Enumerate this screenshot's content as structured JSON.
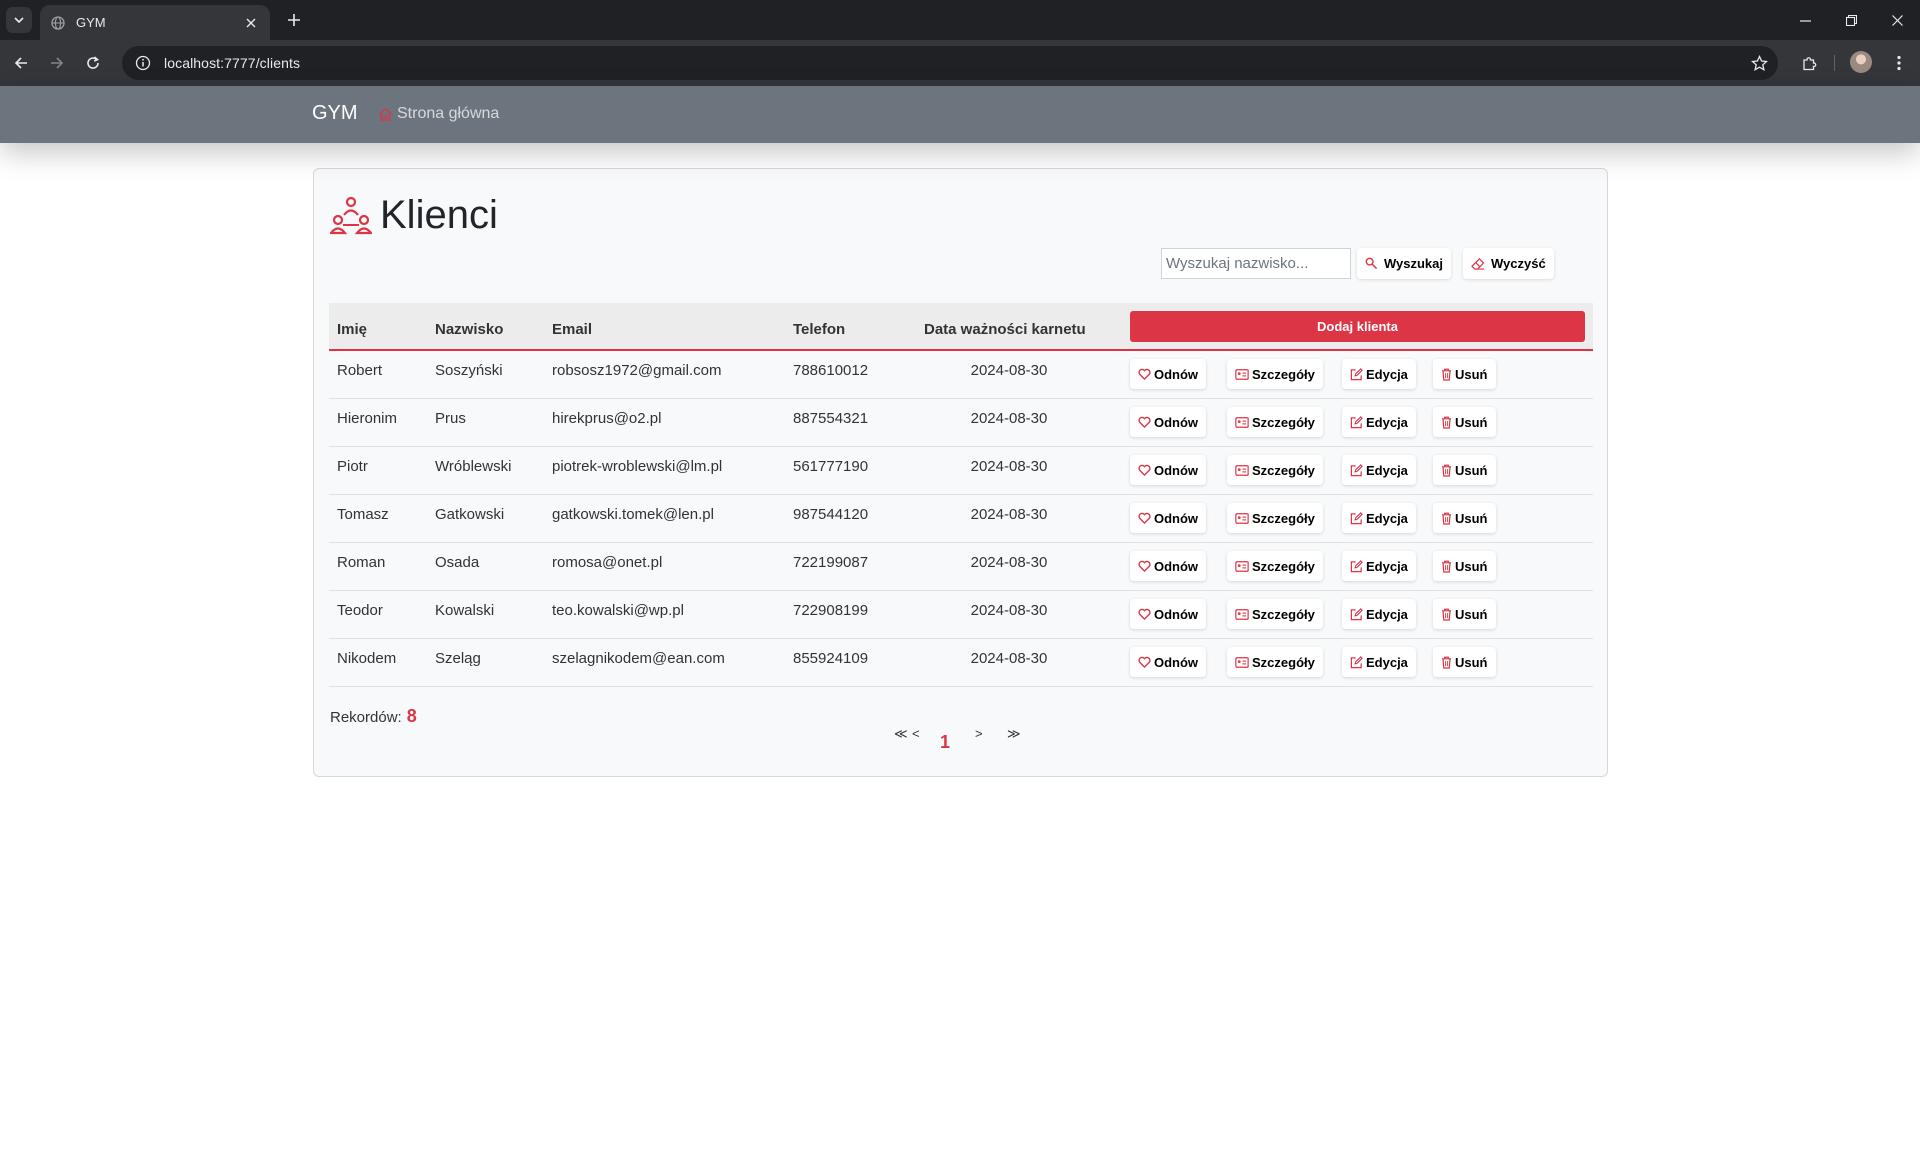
{
  "browser": {
    "tab_title": "GYM",
    "url": "localhost:7777/clients"
  },
  "navbar": {
    "brand": "GYM",
    "home_link": "Strona główna"
  },
  "page": {
    "title": "Klienci",
    "search_placeholder": "Wyszukaj nazwisko...",
    "search_button": "Wyszukaj",
    "clear_button": "Wyczyść",
    "add_button": "Dodaj klienta"
  },
  "table": {
    "columns": [
      "Imię",
      "Nazwisko",
      "Email",
      "Telefon",
      "Data ważności karnetu"
    ],
    "actions": {
      "renew": "Odnów",
      "details": "Szczegóły",
      "edit": "Edycja",
      "delete": "Usuń"
    },
    "rows": [
      {
        "first": "Robert",
        "last": "Soszyński",
        "email": "robsosz1972@gmail.com",
        "phone": "788610012",
        "date": "2024-08-30"
      },
      {
        "first": "Hieronim",
        "last": "Prus",
        "email": "hirekprus@o2.pl",
        "phone": "887554321",
        "date": "2024-08-30"
      },
      {
        "first": "Piotr",
        "last": "Wróblewski",
        "email": "piotrek-wroblewski@lm.pl",
        "phone": "561777190",
        "date": "2024-08-30"
      },
      {
        "first": "Tomasz",
        "last": "Gatkowski",
        "email": "gatkowski.tomek@len.pl",
        "phone": "987544120",
        "date": "2024-08-30"
      },
      {
        "first": "Roman",
        "last": "Osada",
        "email": "romosa@onet.pl",
        "phone": "722199087",
        "date": "2024-08-30"
      },
      {
        "first": "Teodor",
        "last": "Kowalski",
        "email": "teo.kowalski@wp.pl",
        "phone": "722908199",
        "date": "2024-08-30"
      },
      {
        "first": "Nikodem",
        "last": "Szeląg",
        "email": "szelagnikodem@ean.com",
        "phone": "855924109",
        "date": "2024-08-30"
      }
    ]
  },
  "footer": {
    "records_label": "Rekordów:",
    "records_count": "8",
    "pagination": {
      "first": "≪",
      "prev": "<",
      "current": "1",
      "next": ">",
      "last": "≫"
    }
  },
  "colors": {
    "accent": "#dc3545",
    "navbar": "#6c757d",
    "chrome_dark": "#202124",
    "chrome_toolbar": "#35363a"
  },
  "icons": {
    "tab": "globe-icon",
    "nav_home": "house-icon",
    "title": "people-icon",
    "search": "search-icon",
    "clear": "eraser-icon",
    "renew": "heart-icon",
    "details": "card-icon",
    "edit": "pencil-square-icon",
    "delete": "trash-icon"
  }
}
